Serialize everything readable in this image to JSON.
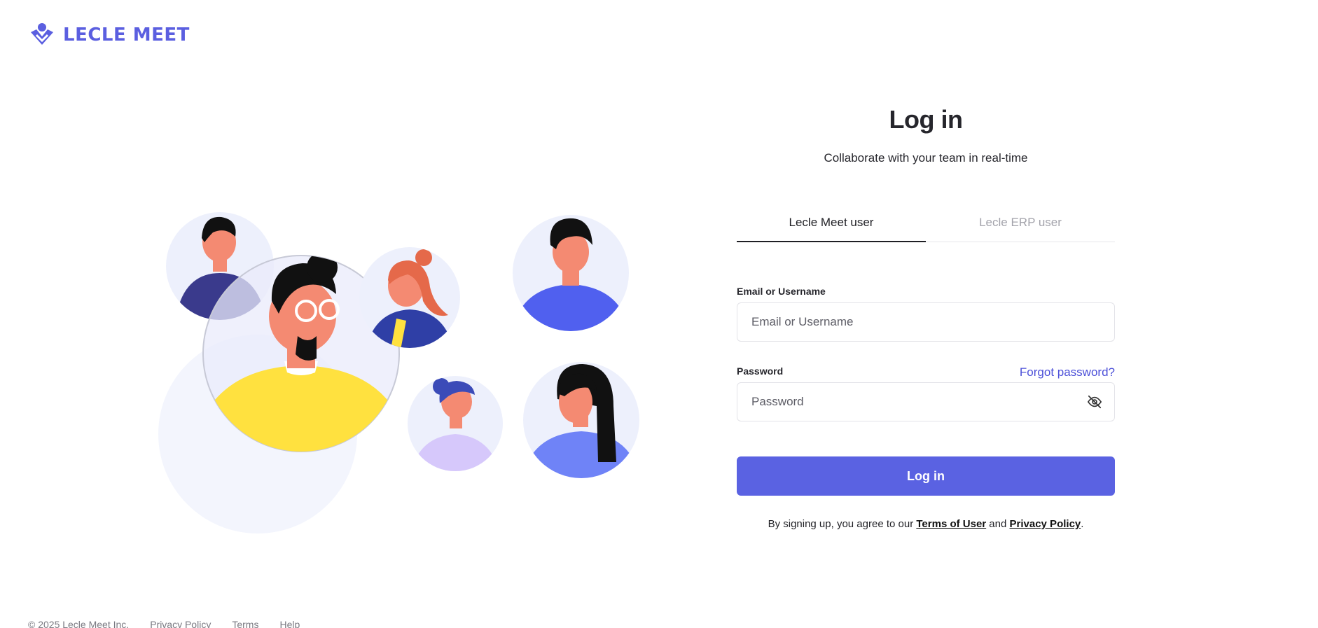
{
  "brand": {
    "name": "LECLE MEET",
    "color": "#5b5fe0"
  },
  "login": {
    "title": "Log in",
    "subtitle": "Collaborate with your team in real-time",
    "tabs": [
      {
        "label": "Lecle Meet user",
        "active": true
      },
      {
        "label": "Lecle ERP user",
        "active": false
      }
    ],
    "email": {
      "label": "Email or Username",
      "placeholder": "Email or Username",
      "value": ""
    },
    "password": {
      "label": "Password",
      "placeholder": "Password",
      "value": "",
      "forgot_label": "Forgot password?",
      "toggle_icon": "eye-off-icon"
    },
    "submit_label": "Log in",
    "accent_color": "#5a62e2",
    "agreement": {
      "prefix": "By signing up, you agree to our ",
      "terms_label": "Terms of User",
      "middle": " and ",
      "privacy_label": "Privacy Policy",
      "suffix": "."
    }
  },
  "footer": {
    "copyright": "© 2025 Lecle Meet Inc.",
    "links": [
      "Privacy Policy",
      "Terms",
      "Help"
    ]
  }
}
